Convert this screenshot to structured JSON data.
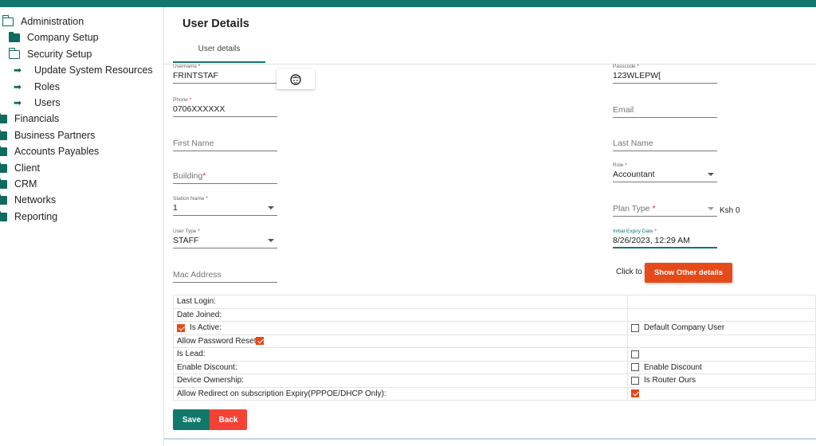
{
  "sidebar": {
    "items": [
      {
        "label": "Administration",
        "icon": "folder-open-icon"
      },
      {
        "label": "Company Setup",
        "icon": "folder-icon"
      },
      {
        "label": "Security Setup",
        "icon": "folder-open-icon"
      },
      {
        "label": "Update System Resources",
        "icon": "arrow-right-icon"
      },
      {
        "label": "Roles",
        "icon": "arrow-right-icon"
      },
      {
        "label": "Users",
        "icon": "arrow-right-icon"
      },
      {
        "label": "Financials",
        "icon": "folder-icon"
      },
      {
        "label": "Business Partners",
        "icon": "folder-icon"
      },
      {
        "label": "Accounts Payables",
        "icon": "folder-icon"
      },
      {
        "label": "Client",
        "icon": "folder-icon"
      },
      {
        "label": "CRM",
        "icon": "folder-icon"
      },
      {
        "label": "Networks",
        "icon": "folder-icon"
      },
      {
        "label": "Reporting",
        "icon": "folder-icon"
      }
    ]
  },
  "main": {
    "title": "User Details",
    "tab": "User details"
  },
  "form": {
    "username": {
      "label": "Username",
      "value": "FRINTSTAF"
    },
    "passcode": {
      "label": "Passcode",
      "value": "123WLEPW["
    },
    "phone": {
      "label": "Phone",
      "value": "0706XXXXXX"
    },
    "email": {
      "placeholder": "Email"
    },
    "first_name": {
      "placeholder": "First Name"
    },
    "last_name": {
      "placeholder": "Last Name"
    },
    "building": {
      "placeholder": "Building"
    },
    "role": {
      "label": "Role",
      "value": "Accountant"
    },
    "station_name": {
      "label": "Station Name",
      "value": "1"
    },
    "plan_type": {
      "placeholder": "Plan Type",
      "currency": "Ksh 0"
    },
    "user_type": {
      "label": "User Type",
      "value": "STAFF"
    },
    "initial_expiry": {
      "label": "Initial Expiry Date",
      "value": "8/26/2023, 12:29 AM"
    },
    "mac_address": {
      "placeholder": "Mac Address"
    },
    "required_mark": "*"
  },
  "other_details": {
    "click_to": "Click to",
    "button": "Show Other details"
  },
  "details_table": {
    "last_login": "Last Login:",
    "date_joined": "Date Joined:",
    "is_active": "Is Active:",
    "default_company_user": "Default Company User",
    "allow_password_reset": "Allow Password Reset",
    "is_lead": "Is Lead:",
    "enable_discount_label": "Enable Discount:",
    "enable_discount": "Enable Discount",
    "device_ownership": "Device Ownership:",
    "is_router_ours": "Is Router Ours",
    "allow_redirect": "Allow Redirect on subscription Expiry(PPPOE/DHCP Only):",
    "checked": {
      "is_active": true,
      "default_company_user": false,
      "allow_password_reset": true,
      "is_lead": false,
      "enable_discount": false,
      "is_router_ours": false,
      "allow_redirect": true
    }
  },
  "actions": {
    "save": "Save",
    "back": "Back"
  },
  "colors": {
    "primary": "#12786c",
    "accent": "#e64a19",
    "danger": "#f44336"
  }
}
